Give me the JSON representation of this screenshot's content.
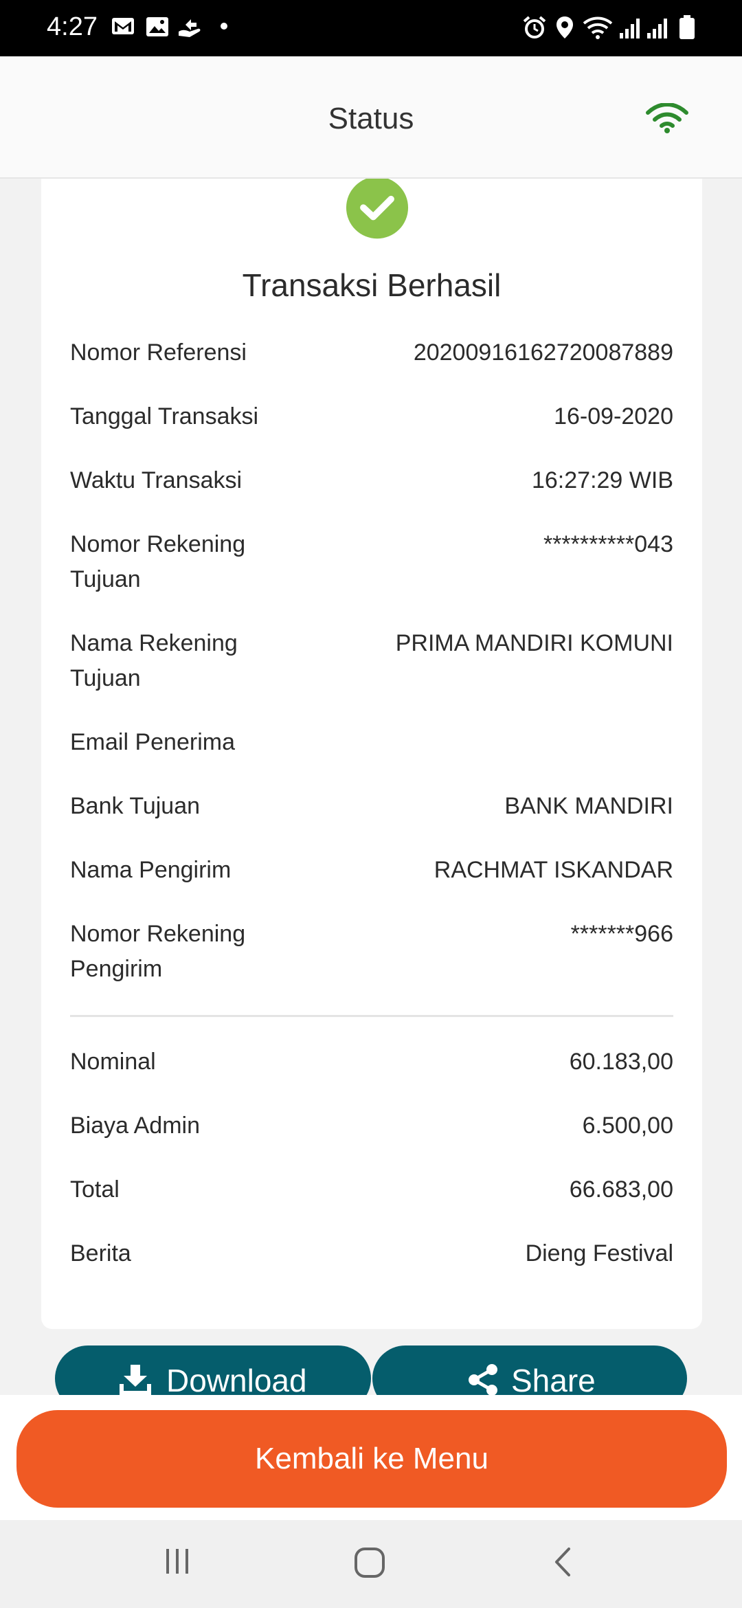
{
  "status_bar": {
    "time": "4:27",
    "left_icons": [
      "gmail-icon",
      "image-icon",
      "app-notification-icon",
      "dot-icon"
    ],
    "right_icons": [
      "alarm-icon",
      "location-icon",
      "wifi-icon",
      "signal-icon",
      "signal-icon",
      "battery-icon"
    ]
  },
  "header": {
    "title": "Status",
    "connection_icon": "wifi-icon",
    "connection_color": "#2e8b2e"
  },
  "receipt": {
    "status_icon": "check-circle-icon",
    "status_color": "#8bc34a",
    "title": "Transaksi Berhasil",
    "details": [
      {
        "label": "Nomor Referensi",
        "value": "20200916162720087889"
      },
      {
        "label": "Tanggal Transaksi",
        "value": "16-09-2020"
      },
      {
        "label": "Waktu Transaksi",
        "value": "16:27:29 WIB"
      },
      {
        "label": "Nomor Rekening Tujuan",
        "value": "**********043"
      },
      {
        "label": "Nama Rekening Tujuan",
        "value": "PRIMA MANDIRI KOMUNI"
      },
      {
        "label": "Email Penerima",
        "value": ""
      },
      {
        "label": "Bank Tujuan",
        "value": "BANK MANDIRI"
      },
      {
        "label": "Nama Pengirim",
        "value": "RACHMAT ISKANDAR"
      },
      {
        "label": "Nomor Rekening Pengirim",
        "value": "*******966"
      }
    ],
    "amounts": [
      {
        "label": "Nominal",
        "value": "60.183,00"
      },
      {
        "label": "Biaya Admin",
        "value": "6.500,00"
      },
      {
        "label": "Total",
        "value": "66.683,00"
      },
      {
        "label": "Berita",
        "value": "Dieng Festival"
      }
    ]
  },
  "actions": {
    "download_label": "Download",
    "download_icon": "download-icon",
    "share_label": "Share",
    "share_icon": "share-icon",
    "button_color": "#055d6c"
  },
  "footer": {
    "menu_button_label": "Kembali ke Menu",
    "menu_button_color": "#f05a24"
  },
  "nav_bar": {
    "icons": [
      "recent-apps-icon",
      "home-icon",
      "back-icon"
    ]
  }
}
